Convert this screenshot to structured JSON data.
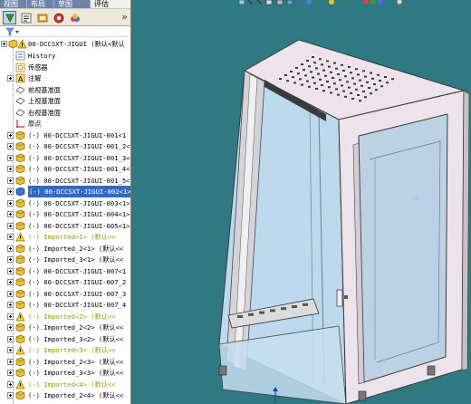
{
  "panel": {
    "tabs": [
      "视图",
      "布局",
      "草图",
      "评估"
    ],
    "more_label": "»",
    "tree": {
      "root": "00-DCCSXT-JIGUI  (默认<默认",
      "items": [
        {
          "label": "History",
          "kind": "history"
        },
        {
          "label": "传感器",
          "kind": "sensor"
        },
        {
          "label": "注解",
          "kind": "annotation"
        },
        {
          "label": "前视基准面",
          "kind": "plane"
        },
        {
          "label": "上视基准面",
          "kind": "plane"
        },
        {
          "label": "右视基准面",
          "kind": "plane"
        },
        {
          "label": "原点",
          "kind": "origin"
        },
        {
          "label": "(-) 00-DCCSXT-JIGUI-001<1",
          "kind": "part"
        },
        {
          "label": "(-) 00-DCCSXT-JIGUI-001_2<",
          "kind": "part"
        },
        {
          "label": "(-) 00-DCCSXT-JIGUI-001_3<",
          "kind": "part"
        },
        {
          "label": "(-) 00-DCCSXT-JIGUI-001_4<",
          "kind": "part"
        },
        {
          "label": "(-) 00-DCCSXT-JIGUI-001_5<",
          "kind": "part"
        },
        {
          "label": "(-) 00-DCCSXT-JIGUI-002<1>",
          "kind": "part-selected"
        },
        {
          "label": "(-) 00-DCCSXT-JIGUI-003<1>",
          "kind": "part"
        },
        {
          "label": "(-) 00-DCCSXT-JIGUI-004<1>",
          "kind": "part"
        },
        {
          "label": "(-) 00-DCCSXT-JIGUI-005<1>",
          "kind": "part"
        },
        {
          "label": "(-) Imported<1> (默认<<",
          "kind": "warn"
        },
        {
          "label": "(-) Imported_2<1> (默认<<",
          "kind": "part"
        },
        {
          "label": "(-) Imported_3<1> (默认<<",
          "kind": "part"
        },
        {
          "label": "(-) 00-DCCSXT-JIGUI-007<1",
          "kind": "part"
        },
        {
          "label": "(-) 00-DCCSXT-JIGUI-007_2",
          "kind": "part"
        },
        {
          "label": "(-) 00-DCCSXT-JIGUI-007_3",
          "kind": "part"
        },
        {
          "label": "(-) 00-DCCSXT-JIGUI-007_4",
          "kind": "part"
        },
        {
          "label": "(-) Imported<2> (默认<<",
          "kind": "warn"
        },
        {
          "label": "(-) Imported_2<2> (默认<<",
          "kind": "part"
        },
        {
          "label": "(-) Imported_3<2> (默认<<",
          "kind": "part"
        },
        {
          "label": "(-) Imported<3> (默认<<",
          "kind": "warn"
        },
        {
          "label": "(-) Imported_2<3> (默认<<",
          "kind": "part"
        },
        {
          "label": "(-) Imported_3<3> (默认<<",
          "kind": "part"
        },
        {
          "label": "(-) Imported<4> (默认<<",
          "kind": "warn"
        },
        {
          "label": "(-) Imported_2<4> (默认<<",
          "kind": "part"
        }
      ]
    }
  },
  "colors": {
    "viewport_bg": "#2f7a82",
    "panel_bg": "#ffffff",
    "selection": "#316ac5",
    "cabinet_face": "#efe8ec",
    "glass": "#bcd9ee",
    "part_icon": "#e8c23a",
    "warn_icon": "#e0b000"
  },
  "viewport": {
    "model": "server-cabinet",
    "toolbar_icons": [
      "zoom-fit-icon",
      "zoom-area-icon",
      "pan-icon",
      "section-icon",
      "view-orientation-icon",
      "display-style-icon",
      "hide-show-icon",
      "appearance-icon",
      "scene-icon"
    ]
  }
}
